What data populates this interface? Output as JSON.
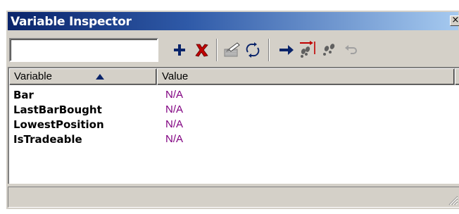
{
  "window": {
    "title": "Variable Inspector",
    "close_symbol": "×"
  },
  "toolbar": {
    "search_value": "",
    "buttons": [
      "add-icon",
      "delete-icon",
      "clear-icon",
      "refresh-icon",
      "go-icon",
      "step-over-icon",
      "step-icon",
      "undo-icon"
    ]
  },
  "list": {
    "columns": [
      {
        "label": "Variable",
        "sort": "ascending"
      },
      {
        "label": "Value"
      }
    ],
    "rows": [
      {
        "variable": "Bar",
        "value": "N/A"
      },
      {
        "variable": "LastBarBought",
        "value": "N/A"
      },
      {
        "variable": "LowestPosition",
        "value": "N/A"
      },
      {
        "variable": "IsTradeable",
        "value": "N/A"
      }
    ]
  },
  "colors": {
    "title_start": "#0a246a",
    "title_end": "#a6caf0",
    "value_text": "#800080",
    "add": "#0a246a",
    "delete": "#c00000"
  }
}
